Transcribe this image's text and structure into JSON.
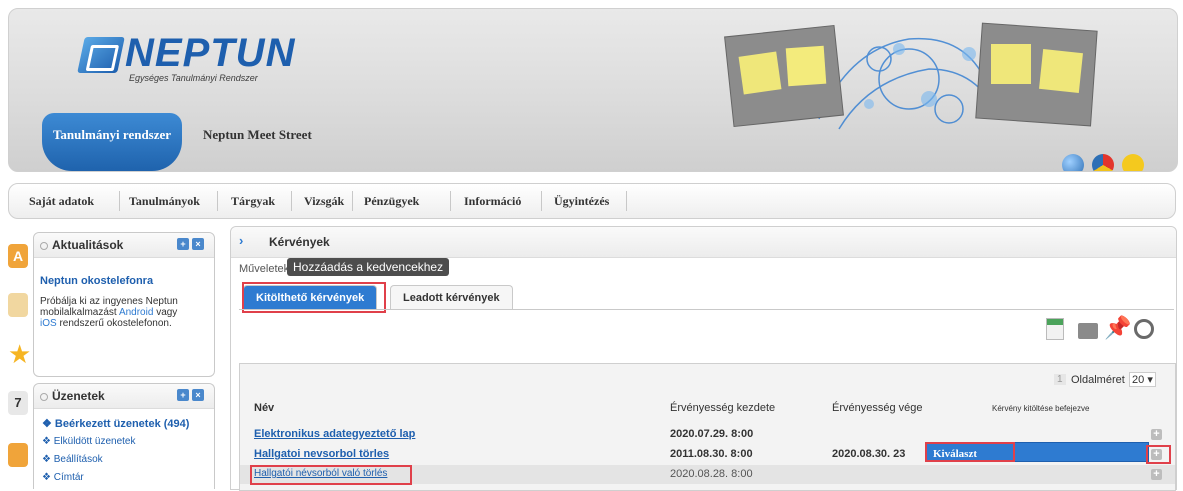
{
  "header": {
    "logo_text": "NEPTUN",
    "logo_subtitle": "Egységes Tanulmányi Rendszer",
    "system_tab": "Tanulmányi rendszer",
    "meet_street": "Neptun Meet Street"
  },
  "menu": [
    "Saját adatok",
    "Tanulmányok",
    "Tárgyak",
    "Vizsgák",
    "Pénzügyek",
    "Információ",
    "Ügyintézés"
  ],
  "sidebar": {
    "news": {
      "title": "Aktualitások",
      "headline": "Neptun okostelefonra",
      "body_1": "Próbálja ki az ingyenes Neptun",
      "body_2": "mobilalkalmazást",
      "android": "Android",
      "body_3": "vagy",
      "ios": "iOS",
      "body_4": "rendszerű okostelefonon."
    },
    "messages": {
      "title": "Üzenetek",
      "items": [
        "Beérkezett üzenetek (494)",
        "Elküldött üzenetek",
        "Beállítások",
        "Címtár"
      ]
    }
  },
  "main": {
    "title": "Kérvények",
    "ops_label": "Műveletek:",
    "fav_button": "Hozzáadás a kedvencekhez",
    "tabs": [
      "Kitölthető kérvények",
      "Leadott kérvények"
    ],
    "page_number": "1",
    "page_size_label": "Oldalméret",
    "page_size": "20",
    "columns": [
      "Név",
      "Érvényesség kezdete",
      "Érvényesség vége",
      "Kérvény kitöltése befejezve"
    ],
    "rows": [
      {
        "name": "Elektronikus adategyeztető lap",
        "start": "2020.07.29. 8:00",
        "end": ""
      },
      {
        "name": "Hallgatoi nevsorbol törles",
        "start": "2011.08.30. 8:00",
        "end": "2020.08.30. 23"
      },
      {
        "name": "Hallgatói névsorból való törlés",
        "start": "2020.08.28. 8:00",
        "end": ""
      }
    ],
    "select_popup": "Kiválaszt"
  },
  "colors": {
    "brand": "#1e5fae",
    "highlight": "#e0404a",
    "select": "#2e7bd1"
  }
}
